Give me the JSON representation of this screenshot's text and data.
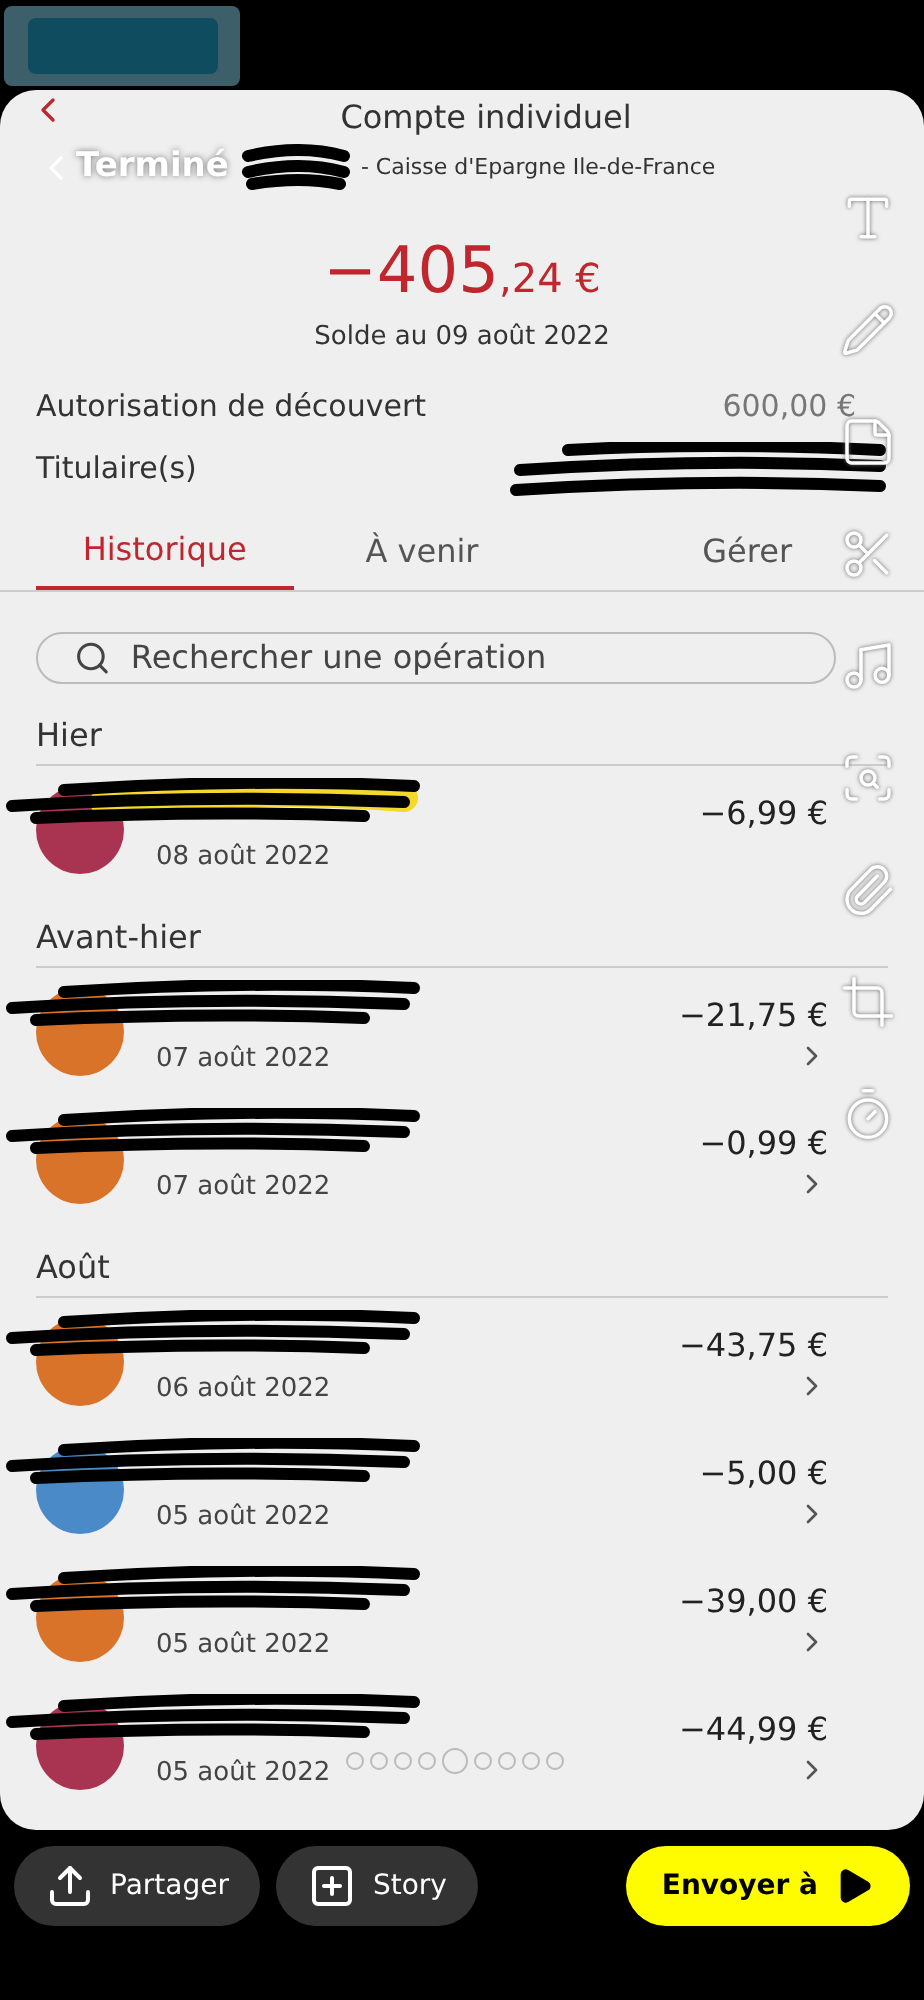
{
  "header": {
    "done": "Terminé",
    "title": "Compte individuel",
    "subtitle": "- Caisse d'Epargne Ile-de-France"
  },
  "balance": {
    "whole": "−405",
    "cents": ",24 €",
    "date": "Solde au 09 août 2022"
  },
  "details": [
    {
      "label": "Autorisation de découvert",
      "value": "600,00 €"
    },
    {
      "label": "Titulaire(s)"
    }
  ],
  "tabs": [
    {
      "label": "Historique",
      "selected": true
    },
    {
      "label": "À venir",
      "selected": false
    },
    {
      "label": "Gérer",
      "selected": false
    }
  ],
  "search": {
    "placeholder": "Rechercher une opération"
  },
  "sections": [
    {
      "title": "Hier",
      "transactions": [
        {
          "date": "08 août 2022",
          "amount": "−6,99 €",
          "color": "#a93452",
          "chevron": false
        }
      ]
    },
    {
      "title": "Avant-hier",
      "transactions": [
        {
          "date": "07 août 2022",
          "amount": "−21,75 €",
          "color": "#d9732a",
          "chevron": true
        },
        {
          "date": "07 août 2022",
          "amount": "−0,99 €",
          "color": "#d9732a",
          "chevron": true
        }
      ]
    },
    {
      "title": "Août",
      "transactions": [
        {
          "date": "06 août 2022",
          "amount": "−43,75 €",
          "color": "#d9732a",
          "chevron": true
        },
        {
          "date": "05 août 2022",
          "amount": "−5,00 €",
          "color": "#4a8ac9",
          "chevron": true
        },
        {
          "date": "05 août 2022",
          "amount": "−39,00 €",
          "color": "#d9732a",
          "chevron": true
        },
        {
          "date": "05 août 2022",
          "amount": "−44,99 €",
          "color": "#a93452",
          "chevron": true
        }
      ]
    }
  ],
  "pager": [
    {
      "selected": false
    },
    {
      "selected": false
    },
    {
      "selected": false
    },
    {
      "selected": false
    },
    {
      "selected": true
    },
    {
      "selected": false
    },
    {
      "selected": false
    },
    {
      "selected": false
    },
    {
      "selected": false
    }
  ],
  "actions": [
    {
      "kind": "share",
      "label": "Partager"
    },
    {
      "kind": "story",
      "label": "Story"
    },
    {
      "kind": "send",
      "label": "Envoyer à"
    }
  ]
}
